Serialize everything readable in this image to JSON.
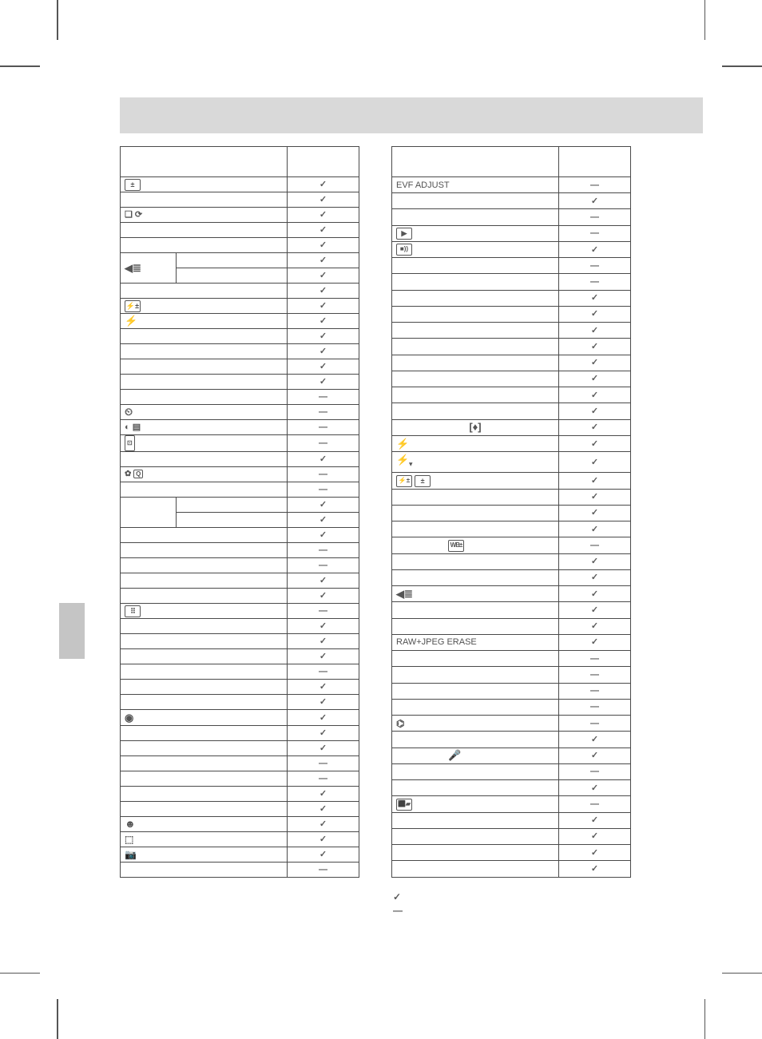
{
  "table1": {
    "header_func": "",
    "header_myset": "",
    "rows": [
      {
        "icon": "±-box",
        "label": "",
        "value": "check"
      },
      {
        "label": "",
        "value": "check"
      },
      {
        "icon": "burst-timer",
        "label": "",
        "value": "check"
      },
      {
        "label": "",
        "value": "check"
      },
      {
        "label": "",
        "value": "check"
      },
      {
        "icon": "dots-rows",
        "label": "",
        "value": "check",
        "split": true,
        "sublabel": ""
      },
      {
        "label": "",
        "value": "check"
      },
      {
        "label": "",
        "value": "check"
      },
      {
        "icon": "flash-box",
        "label": "",
        "value": "check"
      },
      {
        "icon": "flash",
        "label": "",
        "value": "check"
      },
      {
        "label": "",
        "value": "check"
      },
      {
        "label": "",
        "value": "check"
      },
      {
        "label": "",
        "value": "check"
      },
      {
        "label": "",
        "value": "check"
      },
      {
        "label": "",
        "value": "dash"
      },
      {
        "icon": "timer-circle",
        "label": "",
        "value": "dash"
      },
      {
        "icon": "face-plate",
        "label": "",
        "value": "dash"
      },
      {
        "icon": "hdmi",
        "label": "",
        "value": "dash"
      },
      {
        "label": "",
        "value": "check"
      },
      {
        "icon": "gear-q",
        "label": "",
        "value": "dash"
      },
      {
        "label": "",
        "value": "dash"
      },
      {
        "label": "",
        "value": "check",
        "split": true,
        "sublabel": ""
      },
      {
        "label": "",
        "value": "check"
      },
      {
        "label": "",
        "value": "check"
      },
      {
        "label": "",
        "value": "dash"
      },
      {
        "label": "",
        "value": "dash"
      },
      {
        "label": "",
        "value": "check"
      },
      {
        "label": "",
        "value": "check"
      },
      {
        "icon": "af-points",
        "label": "",
        "value": "dash"
      },
      {
        "label": "",
        "value": "check"
      },
      {
        "label": "",
        "value": "check"
      },
      {
        "label": "",
        "value": "check"
      },
      {
        "label": "",
        "value": "dash"
      },
      {
        "label": "",
        "value": "check"
      },
      {
        "label": "",
        "value": "check"
      },
      {
        "icon": "record-dot",
        "label": "",
        "value": "check"
      },
      {
        "label": "",
        "value": "check"
      },
      {
        "label": "",
        "value": "check"
      },
      {
        "label": "",
        "value": "dash"
      },
      {
        "label": "",
        "value": "dash"
      },
      {
        "label": "",
        "value": "check"
      },
      {
        "label": "",
        "value": "check"
      },
      {
        "icon": "face-circle",
        "label": "",
        "value": "check"
      },
      {
        "icon": "crop-marks",
        "label": "",
        "value": "check"
      },
      {
        "icon": "lock-camera",
        "label": "",
        "value": "check"
      },
      {
        "label": "",
        "value": "dash"
      }
    ]
  },
  "table2": {
    "header_func": "",
    "header_myset": "",
    "rows": [
      {
        "label": "EVF ADJUST",
        "value": "dash"
      },
      {
        "label": "",
        "value": "check"
      },
      {
        "label": "",
        "value": "dash"
      },
      {
        "icon": "play-box",
        "label": "",
        "value": "dash"
      },
      {
        "icon": "sound-box",
        "label": "",
        "value": "check"
      },
      {
        "label": "",
        "value": "dash"
      },
      {
        "label": "",
        "value": "dash"
      },
      {
        "label": "",
        "value": "check"
      },
      {
        "label": "",
        "value": "check"
      },
      {
        "label": "",
        "value": "check"
      },
      {
        "label": "",
        "value": "check"
      },
      {
        "label": "",
        "value": "check"
      },
      {
        "label": "",
        "value": "check"
      },
      {
        "label": "",
        "value": "check"
      },
      {
        "label": "",
        "value": "check"
      },
      {
        "label": "",
        "icon_center": "bracket-diamond",
        "value": "check",
        "center": true
      },
      {
        "icon": "flash",
        "label": "",
        "value": "check"
      },
      {
        "icon": "flash-arrow",
        "label": "",
        "value": "check"
      },
      {
        "icon": "flash-boxes",
        "label": "",
        "value": "check"
      },
      {
        "label": "",
        "value": "check"
      },
      {
        "label": "",
        "value": "check"
      },
      {
        "label": "",
        "value": "check"
      },
      {
        "label": "",
        "icon_sub": "wb-box",
        "value": "dash",
        "sub": true
      },
      {
        "label": "",
        "value": "check"
      },
      {
        "label": "",
        "value": "check"
      },
      {
        "icon": "dots-rows",
        "label": "",
        "value": "check"
      },
      {
        "label": "",
        "value": "check"
      },
      {
        "label": "",
        "value": "check"
      },
      {
        "label": "RAW+JPEG ERASE",
        "value": "check"
      },
      {
        "label": "",
        "value": "dash"
      },
      {
        "label": "",
        "value": "dash"
      },
      {
        "label": "",
        "value": "dash"
      },
      {
        "label": "",
        "value": "dash"
      },
      {
        "icon": "video-cam",
        "label": "",
        "value": "dash"
      },
      {
        "label": "",
        "value": "check"
      },
      {
        "label": "",
        "icon_sub": "mic",
        "value": "check",
        "sub": true
      },
      {
        "label": "",
        "value": "dash"
      },
      {
        "label": "",
        "value": "check"
      },
      {
        "icon": "battery-box",
        "label": "",
        "value": "dash"
      },
      {
        "label": "",
        "value": "check"
      },
      {
        "label": "",
        "value": "check"
      },
      {
        "label": "",
        "value": "check"
      },
      {
        "label": "",
        "value": "check"
      }
    ]
  },
  "legend": {
    "check_text": "",
    "dash_text": ""
  }
}
